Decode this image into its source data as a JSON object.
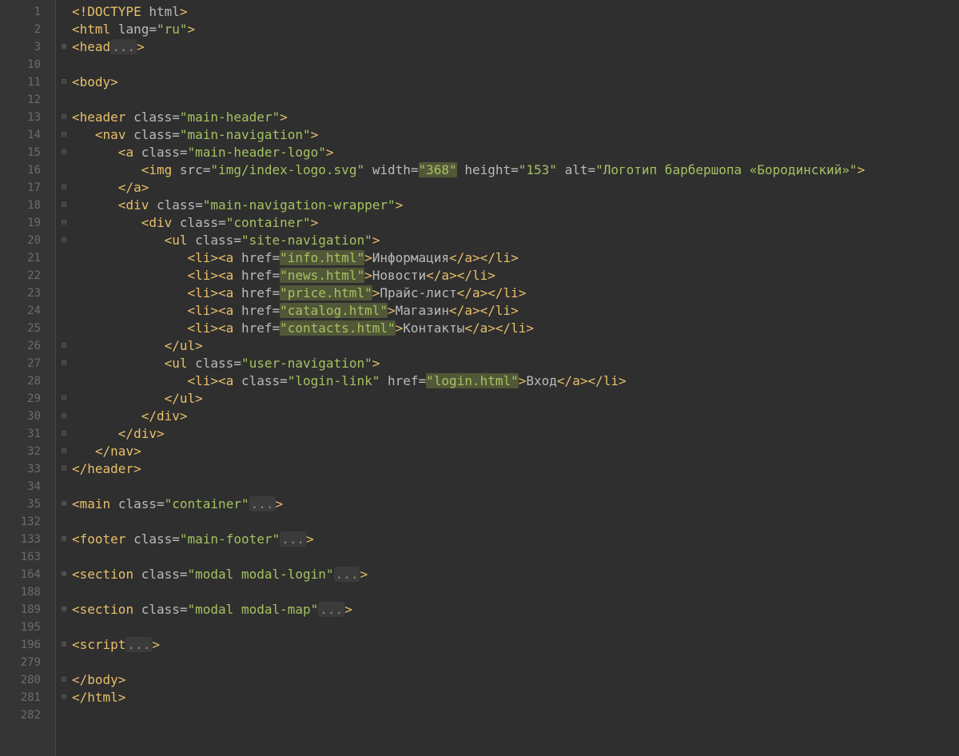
{
  "gutter_numbers": [
    "1",
    "2",
    "3",
    "10",
    "11",
    "12",
    "13",
    "14",
    "15",
    "16",
    "17",
    "18",
    "19",
    "20",
    "21",
    "22",
    "23",
    "24",
    "25",
    "26",
    "27",
    "28",
    "29",
    "30",
    "31",
    "32",
    "33",
    "34",
    "35",
    "132",
    "133",
    "163",
    "164",
    "188",
    "189",
    "195",
    "196",
    "279",
    "280",
    "281",
    "282"
  ],
  "fold_markers": [
    "",
    "",
    "+",
    "",
    "-",
    "",
    "-",
    "-",
    "-",
    "",
    "-",
    "-",
    "-",
    "-",
    "",
    "",
    "",
    "",
    "",
    "-",
    "-",
    "",
    "-",
    "-",
    "-",
    "-",
    "-",
    "",
    "+",
    "",
    "+",
    "",
    "+",
    "",
    "+",
    "",
    "+",
    "",
    "-",
    "-",
    ""
  ],
  "code_lines": [
    {
      "indent": 0,
      "segs": [
        [
          "p",
          "<!"
        ],
        [
          "t",
          "DOCTYPE "
        ],
        [
          "a",
          "html"
        ],
        [
          "p",
          ">"
        ]
      ]
    },
    {
      "indent": 0,
      "segs": [
        [
          "p",
          "<"
        ],
        [
          "t",
          "html "
        ],
        [
          "a",
          "lang"
        ],
        [
          "eq",
          "="
        ],
        [
          "s",
          "\"ru\""
        ],
        [
          "p",
          ">"
        ]
      ]
    },
    {
      "indent": 0,
      "segs": [
        [
          "p",
          "<"
        ],
        [
          "t",
          "head"
        ],
        [
          "fold",
          "..."
        ],
        [
          "p",
          ">"
        ]
      ]
    },
    {
      "indent": 0,
      "segs": []
    },
    {
      "indent": 0,
      "segs": [
        [
          "p",
          "<"
        ],
        [
          "t",
          "body"
        ],
        [
          "p",
          ">"
        ]
      ]
    },
    {
      "indent": 0,
      "segs": []
    },
    {
      "indent": 0,
      "segs": [
        [
          "p",
          "<"
        ],
        [
          "t",
          "header "
        ],
        [
          "a",
          "class"
        ],
        [
          "eq",
          "="
        ],
        [
          "s",
          "\"main-header\""
        ],
        [
          "p",
          ">"
        ]
      ]
    },
    {
      "indent": 1,
      "segs": [
        [
          "p",
          "<"
        ],
        [
          "t",
          "nav "
        ],
        [
          "a",
          "class"
        ],
        [
          "eq",
          "="
        ],
        [
          "s",
          "\"main-navigation\""
        ],
        [
          "p",
          ">"
        ]
      ]
    },
    {
      "indent": 2,
      "segs": [
        [
          "p",
          "<"
        ],
        [
          "t",
          "a "
        ],
        [
          "a",
          "class"
        ],
        [
          "eq",
          "="
        ],
        [
          "s",
          "\"main-header-logo\""
        ],
        [
          "p",
          ">"
        ]
      ]
    },
    {
      "indent": 3,
      "segs": [
        [
          "p",
          "<"
        ],
        [
          "t",
          "img "
        ],
        [
          "a",
          "src"
        ],
        [
          "eq",
          "="
        ],
        [
          "s",
          "\"img/index-logo.svg\""
        ],
        [
          "a",
          " width"
        ],
        [
          "eq",
          "="
        ],
        [
          "sh",
          "\"368\""
        ],
        [
          "a",
          " height"
        ],
        [
          "eq",
          "="
        ],
        [
          "s",
          "\"153\""
        ],
        [
          "a",
          " alt"
        ],
        [
          "eq",
          "="
        ],
        [
          "s",
          "\"Логотип барбершопа «Бородинский»\""
        ],
        [
          "p",
          ">"
        ]
      ]
    },
    {
      "indent": 2,
      "segs": [
        [
          "p",
          "</"
        ],
        [
          "t",
          "a"
        ],
        [
          "p",
          ">"
        ]
      ]
    },
    {
      "indent": 2,
      "segs": [
        [
          "p",
          "<"
        ],
        [
          "t",
          "div "
        ],
        [
          "a",
          "class"
        ],
        [
          "eq",
          "="
        ],
        [
          "s",
          "\"main-navigation-wrapper\""
        ],
        [
          "p",
          ">"
        ]
      ]
    },
    {
      "indent": 3,
      "segs": [
        [
          "p",
          "<"
        ],
        [
          "t",
          "div "
        ],
        [
          "a",
          "class"
        ],
        [
          "eq",
          "="
        ],
        [
          "s",
          "\"container\""
        ],
        [
          "p",
          ">"
        ]
      ]
    },
    {
      "indent": 4,
      "segs": [
        [
          "p",
          "<"
        ],
        [
          "t",
          "ul "
        ],
        [
          "a",
          "class"
        ],
        [
          "eq",
          "="
        ],
        [
          "s",
          "\"site-navigation\""
        ],
        [
          "p",
          ">"
        ]
      ]
    },
    {
      "indent": 5,
      "segs": [
        [
          "p",
          "<"
        ],
        [
          "t",
          "li"
        ],
        [
          "p",
          "><"
        ],
        [
          "t",
          "a "
        ],
        [
          "a",
          "href"
        ],
        [
          "eq",
          "="
        ],
        [
          "sh",
          "\"info.html\""
        ],
        [
          "p",
          ">"
        ],
        [
          "tx",
          "Информация"
        ],
        [
          "p",
          "</"
        ],
        [
          "t",
          "a"
        ],
        [
          "p",
          "></"
        ],
        [
          "t",
          "li"
        ],
        [
          "p",
          ">"
        ]
      ]
    },
    {
      "indent": 5,
      "segs": [
        [
          "p",
          "<"
        ],
        [
          "t",
          "li"
        ],
        [
          "p",
          "><"
        ],
        [
          "t",
          "a "
        ],
        [
          "a",
          "href"
        ],
        [
          "eq",
          "="
        ],
        [
          "sh",
          "\"news.html\""
        ],
        [
          "p",
          ">"
        ],
        [
          "tx",
          "Новости"
        ],
        [
          "p",
          "</"
        ],
        [
          "t",
          "a"
        ],
        [
          "p",
          "></"
        ],
        [
          "t",
          "li"
        ],
        [
          "p",
          ">"
        ]
      ]
    },
    {
      "indent": 5,
      "segs": [
        [
          "p",
          "<"
        ],
        [
          "t",
          "li"
        ],
        [
          "p",
          "><"
        ],
        [
          "t",
          "a "
        ],
        [
          "a",
          "href"
        ],
        [
          "eq",
          "="
        ],
        [
          "sh",
          "\"price.html\""
        ],
        [
          "p",
          ">"
        ],
        [
          "tx",
          "Прайс-лист"
        ],
        [
          "p",
          "</"
        ],
        [
          "t",
          "a"
        ],
        [
          "p",
          "></"
        ],
        [
          "t",
          "li"
        ],
        [
          "p",
          ">"
        ]
      ]
    },
    {
      "indent": 5,
      "segs": [
        [
          "p",
          "<"
        ],
        [
          "t",
          "li"
        ],
        [
          "p",
          "><"
        ],
        [
          "t",
          "a "
        ],
        [
          "a",
          "href"
        ],
        [
          "eq",
          "="
        ],
        [
          "sh",
          "\"catalog.html\""
        ],
        [
          "p",
          ">"
        ],
        [
          "tx",
          "Магазин"
        ],
        [
          "p",
          "</"
        ],
        [
          "t",
          "a"
        ],
        [
          "p",
          "></"
        ],
        [
          "t",
          "li"
        ],
        [
          "p",
          ">"
        ]
      ]
    },
    {
      "indent": 5,
      "segs": [
        [
          "p",
          "<"
        ],
        [
          "t",
          "li"
        ],
        [
          "p",
          "><"
        ],
        [
          "t",
          "a "
        ],
        [
          "a",
          "href"
        ],
        [
          "eq",
          "="
        ],
        [
          "sh",
          "\"contacts.html\""
        ],
        [
          "p",
          ">"
        ],
        [
          "tx",
          "Контакты"
        ],
        [
          "p",
          "</"
        ],
        [
          "t",
          "a"
        ],
        [
          "p",
          "></"
        ],
        [
          "t",
          "li"
        ],
        [
          "p",
          ">"
        ]
      ]
    },
    {
      "indent": 4,
      "segs": [
        [
          "p",
          "</"
        ],
        [
          "t",
          "ul"
        ],
        [
          "p",
          ">"
        ]
      ]
    },
    {
      "indent": 4,
      "segs": [
        [
          "p",
          "<"
        ],
        [
          "t",
          "ul "
        ],
        [
          "a",
          "class"
        ],
        [
          "eq",
          "="
        ],
        [
          "s",
          "\"user-navigation\""
        ],
        [
          "p",
          ">"
        ]
      ]
    },
    {
      "indent": 5,
      "segs": [
        [
          "p",
          "<"
        ],
        [
          "t",
          "li"
        ],
        [
          "p",
          "><"
        ],
        [
          "t",
          "a "
        ],
        [
          "a",
          "class"
        ],
        [
          "eq",
          "="
        ],
        [
          "s",
          "\"login-link\""
        ],
        [
          "a",
          " href"
        ],
        [
          "eq",
          "="
        ],
        [
          "sh",
          "\"login.html\""
        ],
        [
          "p",
          ">"
        ],
        [
          "tx",
          "Вход"
        ],
        [
          "p",
          "</"
        ],
        [
          "t",
          "a"
        ],
        [
          "p",
          "></"
        ],
        [
          "t",
          "li"
        ],
        [
          "p",
          ">"
        ]
      ]
    },
    {
      "indent": 4,
      "segs": [
        [
          "p",
          "</"
        ],
        [
          "t",
          "ul"
        ],
        [
          "p",
          ">"
        ]
      ]
    },
    {
      "indent": 3,
      "segs": [
        [
          "p",
          "</"
        ],
        [
          "t",
          "div"
        ],
        [
          "p",
          ">"
        ]
      ]
    },
    {
      "indent": 2,
      "segs": [
        [
          "p",
          "</"
        ],
        [
          "t",
          "div"
        ],
        [
          "p",
          ">"
        ]
      ]
    },
    {
      "indent": 1,
      "segs": [
        [
          "p",
          "</"
        ],
        [
          "t",
          "nav"
        ],
        [
          "p",
          ">"
        ]
      ]
    },
    {
      "indent": 0,
      "segs": [
        [
          "p",
          "</"
        ],
        [
          "t",
          "header"
        ],
        [
          "p",
          ">"
        ]
      ]
    },
    {
      "indent": 0,
      "segs": []
    },
    {
      "indent": 0,
      "segs": [
        [
          "p",
          "<"
        ],
        [
          "t",
          "main "
        ],
        [
          "a",
          "class"
        ],
        [
          "eq",
          "="
        ],
        [
          "s",
          "\"container\""
        ],
        [
          "fold",
          "..."
        ],
        [
          "p",
          ">"
        ]
      ]
    },
    {
      "indent": 0,
      "segs": []
    },
    {
      "indent": 0,
      "segs": [
        [
          "p",
          "<"
        ],
        [
          "t",
          "footer "
        ],
        [
          "a",
          "class"
        ],
        [
          "eq",
          "="
        ],
        [
          "s",
          "\"main-footer\""
        ],
        [
          "fold",
          "..."
        ],
        [
          "p",
          ">"
        ]
      ]
    },
    {
      "indent": 0,
      "segs": []
    },
    {
      "indent": 0,
      "segs": [
        [
          "p",
          "<"
        ],
        [
          "t",
          "section "
        ],
        [
          "a",
          "class"
        ],
        [
          "eq",
          "="
        ],
        [
          "s",
          "\"modal modal-login\""
        ],
        [
          "fold",
          "..."
        ],
        [
          "p",
          ">"
        ]
      ]
    },
    {
      "indent": 0,
      "segs": []
    },
    {
      "indent": 0,
      "segs": [
        [
          "p",
          "<"
        ],
        [
          "t",
          "section "
        ],
        [
          "a",
          "class"
        ],
        [
          "eq",
          "="
        ],
        [
          "s",
          "\"modal modal-map\""
        ],
        [
          "fold",
          "..."
        ],
        [
          "p",
          ">"
        ]
      ]
    },
    {
      "indent": 0,
      "segs": []
    },
    {
      "indent": 0,
      "segs": [
        [
          "p",
          "<"
        ],
        [
          "t",
          "script"
        ],
        [
          "fold",
          "..."
        ],
        [
          "p",
          ">"
        ]
      ]
    },
    {
      "indent": 0,
      "segs": []
    },
    {
      "indent": 0,
      "segs": [
        [
          "p",
          "</"
        ],
        [
          "t",
          "body"
        ],
        [
          "p",
          ">"
        ]
      ]
    },
    {
      "indent": 0,
      "segs": [
        [
          "p",
          "</"
        ],
        [
          "t",
          "html"
        ],
        [
          "p",
          ">"
        ]
      ]
    },
    {
      "indent": 0,
      "segs": []
    }
  ],
  "indent_unit": "   "
}
